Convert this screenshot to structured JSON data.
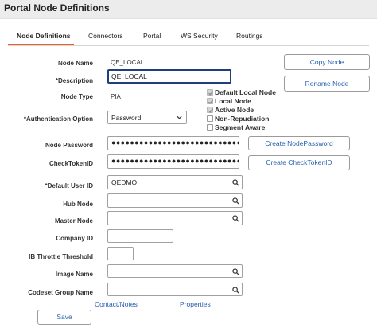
{
  "page": {
    "title": "Portal Node Definitions"
  },
  "tabs": [
    {
      "label": "Node Definitions",
      "active": true
    },
    {
      "label": "Connectors"
    },
    {
      "label": "Portal"
    },
    {
      "label": "WS Security"
    },
    {
      "label": "Routings"
    }
  ],
  "form": {
    "node_name": {
      "label": "Node Name",
      "value": "QE_LOCAL"
    },
    "description": {
      "label": "*Description",
      "value": "QE_LOCAL"
    },
    "node_type": {
      "label": "Node Type",
      "value": "PIA"
    },
    "auth_option": {
      "label": "*Authentication Option",
      "value": "Password"
    },
    "node_password": {
      "label": "Node Password",
      "value": "●●●●●●●●●●●●●●●●●●●●●●●●●●●●●●●●●●"
    },
    "checktoken_id": {
      "label": "CheckTokenID",
      "value": "●●●●●●●●●●●●●●●●●●●●●●●●●●●●●●●●●●"
    },
    "default_user_id": {
      "label": "*Default User ID",
      "value": "QEDMO"
    },
    "hub_node": {
      "label": "Hub Node",
      "value": ""
    },
    "master_node": {
      "label": "Master Node",
      "value": ""
    },
    "company_id": {
      "label": "Company ID",
      "value": ""
    },
    "ib_throttle": {
      "label": "IB Throttle Threshold",
      "value": ""
    },
    "image_name": {
      "label": "Image Name",
      "value": ""
    },
    "codeset_group": {
      "label": "Codeset Group Name",
      "value": ""
    }
  },
  "checkboxes": [
    {
      "label": "Default Local Node",
      "checked": true,
      "disabled": true
    },
    {
      "label": "Local Node",
      "checked": true,
      "disabled": true
    },
    {
      "label": "Active Node",
      "checked": true,
      "disabled": true
    },
    {
      "label": "Non-Repudiation",
      "checked": false
    },
    {
      "label": "Segment Aware",
      "checked": false
    }
  ],
  "buttons": {
    "copy_node": "Copy Node",
    "rename_node": "Rename Node",
    "create_node_password": "Create NodePassword",
    "create_checktoken": "Create CheckTokenID",
    "save": "Save"
  },
  "links": {
    "contact_notes": "Contact/Notes",
    "properties": "Properties"
  },
  "colors": {
    "link": "#2860b0",
    "tab_accent": "#e8622a",
    "focus_border": "#1f3f7a"
  }
}
